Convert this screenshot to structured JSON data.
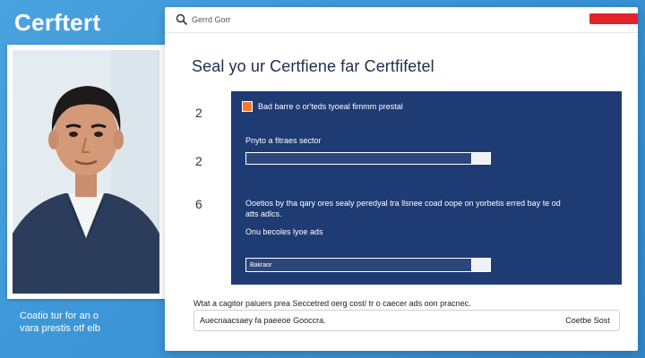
{
  "brand": {
    "title": "Cerftert"
  },
  "left_caption": {
    "line1": "Coatio tur for an o",
    "line2": "vara prestis otf elb"
  },
  "topbar": {
    "search_placeholder": "Gerrd Gorr",
    "button_label": ""
  },
  "page": {
    "title": "Seal yo ur Certfiene far Certfifetel"
  },
  "steps": {
    "step1": "2",
    "step2": "2",
    "step3": "6"
  },
  "panel": {
    "header": "Bad barre o or'teds tyoeal fimmm prestal",
    "field1_label": "Pnyto a fitraes sector",
    "field1_value": "",
    "field1_button": "",
    "paragraph_line1": "Ooetios by tha qary ores sealy peredyal tra llsnee coad oope on yorbetis erred bay te od",
    "paragraph_line2": "atts adlcs.",
    "field2_label": "Onu becoles lyoe ads",
    "field2_value": "Bakraor",
    "field2_button": ""
  },
  "bottom": {
    "label": "Wtat a cagitor paluers prea Seccetred oerg cost/ tr o caecer ads oon pracnec.",
    "input_placeholder": "Auecnaacsaey fa paeeoe Gooccra.",
    "button_label": "Coetbe Sost"
  },
  "colors": {
    "accent_red": "#e3242b",
    "panel_blue": "#1e3b73",
    "background_blue": "#3b95d6",
    "panel_icon_orange": "#f07a2a"
  }
}
